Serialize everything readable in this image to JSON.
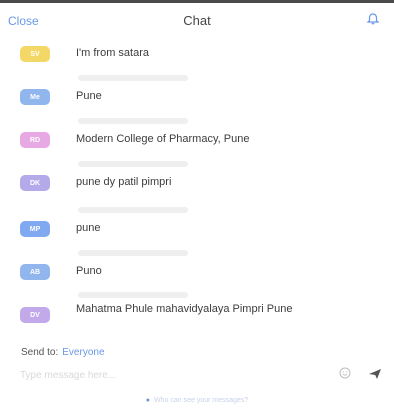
{
  "header": {
    "close_label": "Close",
    "title": "Chat"
  },
  "messages": [
    {
      "initials": "SV",
      "color": "#f2d24e",
      "text": "I'm from satara"
    },
    {
      "initials": "Me",
      "color": "#7ea9ea",
      "text": "Pune"
    },
    {
      "initials": "RD",
      "color": "#e39be0",
      "text": "Modern College of Pharmacy, Pune"
    },
    {
      "initials": "DK",
      "color": "#a89be6",
      "text": "pune dy patil pimpri"
    },
    {
      "initials": "MP",
      "color": "#6c9bf0",
      "text": "pune"
    },
    {
      "initials": "AB",
      "color": "#7ea9ea",
      "text": "Puno"
    },
    {
      "initials": "DV",
      "color": "#b89be6",
      "text": "Mahatma Phule mahavidyalaya Pimpri Pune"
    }
  ],
  "send_to": {
    "label": "Send to:",
    "target": "Everyone"
  },
  "composer": {
    "placeholder": "Type message here..."
  },
  "footer": {
    "note": "Who can see your messages?"
  },
  "colors": {
    "accent": "#6a97e6"
  }
}
